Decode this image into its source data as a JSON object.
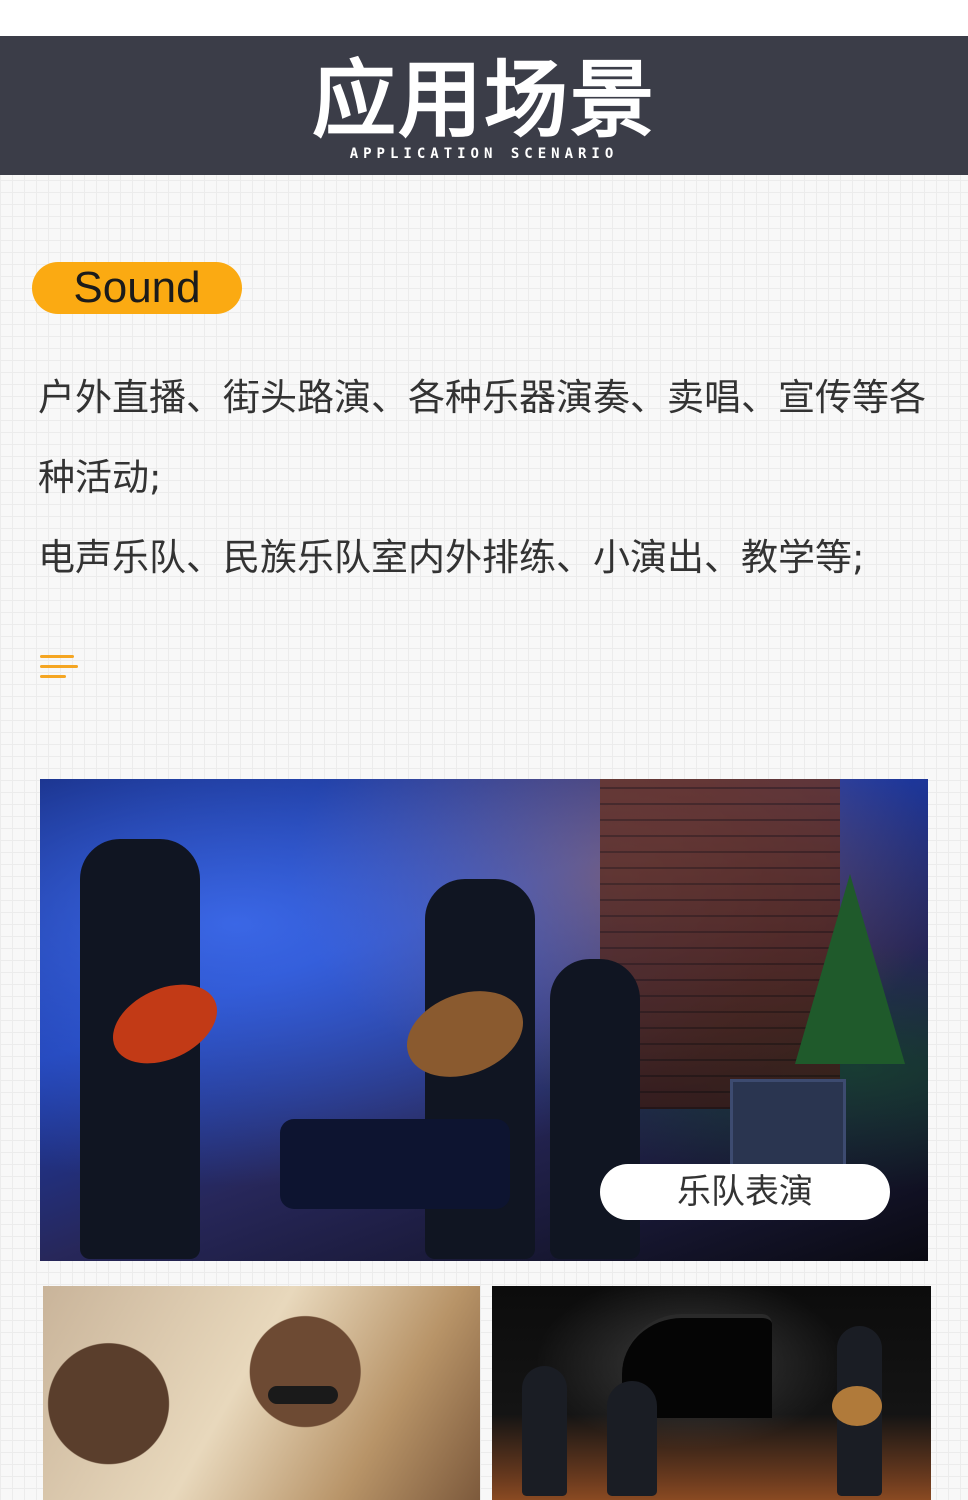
{
  "header": {
    "title": "应用场景",
    "subtitle": "APPLICATION SCENARIO"
  },
  "badge": {
    "label": "Sound"
  },
  "description": {
    "line1": "户外直播、街头路演、各种乐器演奏、卖唱、宣传等各种活动;",
    "line2": "电声乐队、民族乐队室内外排练、小演出、教学等;"
  },
  "icons": {
    "menu": "menu-lines-icon"
  },
  "gallery": {
    "main_caption": "乐队表演"
  },
  "colors": {
    "header_bg": "#3b3d48",
    "accent": "#fbaa12",
    "menu_icon": "#f5a623"
  }
}
